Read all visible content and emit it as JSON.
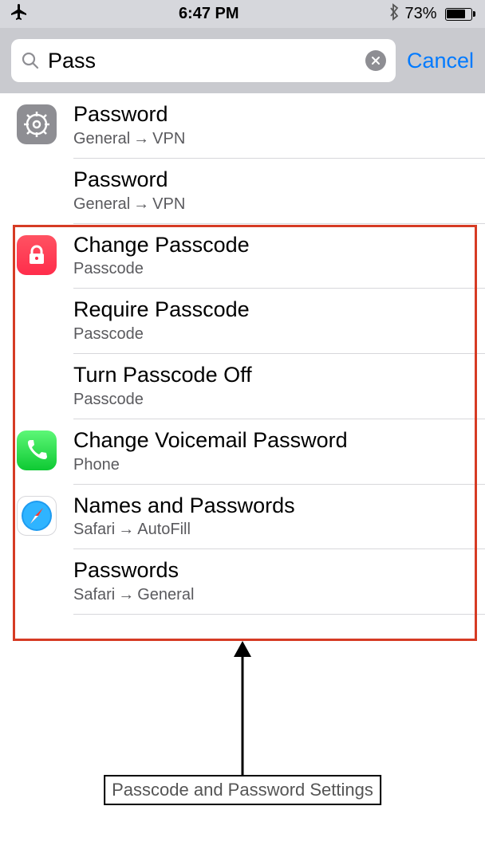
{
  "status": {
    "time": "6:47 PM",
    "battery_pct": "73%"
  },
  "search": {
    "value": "Pass",
    "cancel_label": "Cancel"
  },
  "results": [
    {
      "icon": "settings",
      "title": "Password",
      "path": [
        "General",
        "VPN"
      ]
    },
    {
      "icon": "",
      "title": "Password",
      "path": [
        "General",
        "VPN"
      ]
    },
    {
      "icon": "passcode",
      "title": "Change Passcode",
      "path": [
        "Passcode"
      ]
    },
    {
      "icon": "",
      "title": "Require Passcode",
      "path": [
        "Passcode"
      ]
    },
    {
      "icon": "",
      "title": "Turn Passcode Off",
      "path": [
        "Passcode"
      ]
    },
    {
      "icon": "phone",
      "title": "Change Voicemail Password",
      "path": [
        "Phone"
      ]
    },
    {
      "icon": "safari",
      "title": "Names and Passwords",
      "path": [
        "Safari",
        "AutoFill"
      ]
    },
    {
      "icon": "",
      "title": "Passwords",
      "path": [
        "Safari",
        "General"
      ]
    }
  ],
  "annotation": {
    "caption": "Passcode and Password Settings"
  }
}
